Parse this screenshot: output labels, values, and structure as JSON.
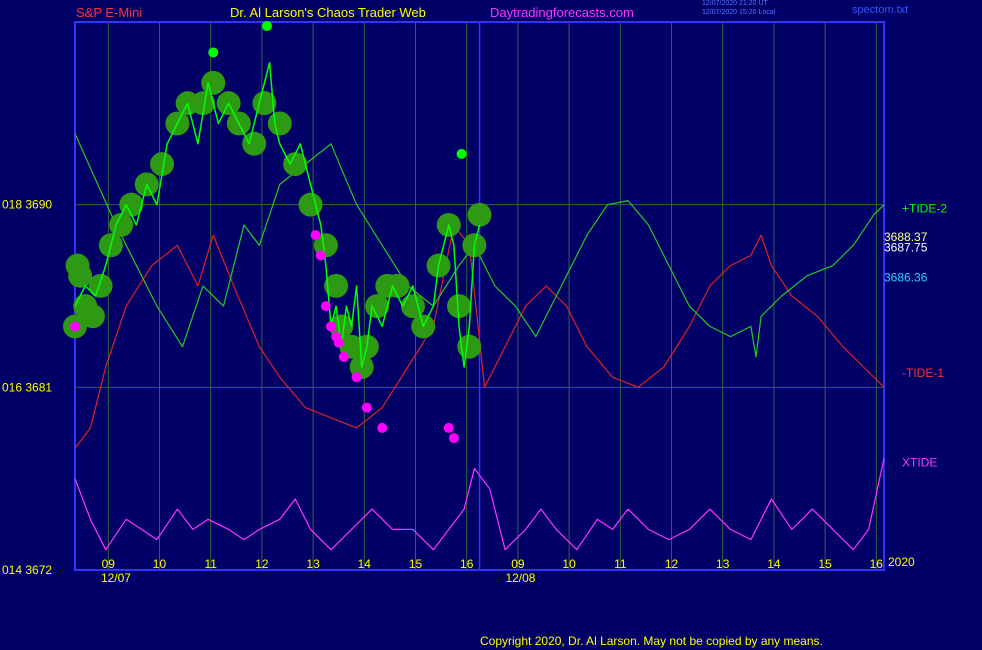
{
  "header": {
    "symbol": "S&P E-Mini",
    "site_title": "Dr. Al Larson's Chaos Trader Web",
    "site_url": "Daytradingforecasts.com",
    "stamp_ut": "12/07/2020 21:20 UT",
    "stamp_local": "12/07/2020 15:20 Local",
    "filename": "spectom.txt",
    "copyright": "Copyright 2020, Dr. Al Larson. May not be copied by any means."
  },
  "colors": {
    "background": "#000066",
    "frame": "#3333ff",
    "grid": "#336633",
    "price": "#00ff00",
    "price_glow": "#2e9a14",
    "signal_dot": "#ff00ff",
    "fast_avg": "#ffff00",
    "mid_avg": "#33ccff",
    "slow_avg": "#ffffff",
    "tide_plus2": "#22cc22",
    "tide_minus1": "#dd2222",
    "xtide": "#ff33ff",
    "axis_text": "#ffff00"
  },
  "chart_data": {
    "type": "line",
    "title": "S&P E-Mini",
    "y_axis": {
      "ticks": [
        {
          "price": 3672,
          "label": "014  3672"
        },
        {
          "price": 3681,
          "label": "016  3681"
        },
        {
          "price": 3690,
          "label": "018  3690"
        }
      ]
    },
    "x_axis": {
      "hour_ticks": [
        {
          "x": 0.65,
          "label": "09"
        },
        {
          "x": 1.65,
          "label": "10"
        },
        {
          "x": 2.65,
          "label": "11"
        },
        {
          "x": 3.65,
          "label": "12"
        },
        {
          "x": 4.65,
          "label": "13"
        },
        {
          "x": 5.65,
          "label": "14"
        },
        {
          "x": 6.65,
          "label": "15"
        },
        {
          "x": 7.65,
          "label": "16"
        },
        {
          "x": 8.65,
          "label": "09"
        },
        {
          "x": 9.65,
          "label": "10"
        },
        {
          "x": 10.65,
          "label": "11"
        },
        {
          "x": 11.65,
          "label": "12"
        },
        {
          "x": 12.65,
          "label": "13"
        },
        {
          "x": 13.65,
          "label": "14"
        },
        {
          "x": 14.65,
          "label": "15"
        },
        {
          "x": 15.65,
          "label": "16"
        }
      ],
      "date_labels": [
        {
          "x": 0.8,
          "label": "12/07"
        },
        {
          "x": 8.7,
          "label": "12/08"
        }
      ],
      "year_label": "2020",
      "now_x": 7.9,
      "range": [
        0,
        15.8
      ]
    },
    "y_range": [
      3672,
      3699
    ],
    "price": [
      [
        0,
        3685
      ],
      [
        0.2,
        3686
      ],
      [
        0.4,
        3685.5
      ],
      [
        0.6,
        3687
      ],
      [
        0.8,
        3689
      ],
      [
        1,
        3690
      ],
      [
        1.2,
        3689
      ],
      [
        1.4,
        3691
      ],
      [
        1.6,
        3690
      ],
      [
        1.8,
        3693
      ],
      [
        2,
        3694
      ],
      [
        2.2,
        3695
      ],
      [
        2.4,
        3693
      ],
      [
        2.6,
        3696
      ],
      [
        2.8,
        3694
      ],
      [
        3,
        3695
      ],
      [
        3.2,
        3694
      ],
      [
        3.4,
        3693
      ],
      [
        3.6,
        3695
      ],
      [
        3.8,
        3697
      ],
      [
        3.9,
        3694
      ],
      [
        4,
        3693
      ],
      [
        4.2,
        3692
      ],
      [
        4.4,
        3693
      ],
      [
        4.6,
        3691
      ],
      [
        4.8,
        3689
      ],
      [
        4.9,
        3687
      ],
      [
        5,
        3684
      ],
      [
        5.1,
        3685
      ],
      [
        5.2,
        3683
      ],
      [
        5.3,
        3685
      ],
      [
        5.4,
        3684
      ],
      [
        5.5,
        3686
      ],
      [
        5.6,
        3682
      ],
      [
        5.7,
        3683
      ],
      [
        5.8,
        3685
      ],
      [
        6,
        3684
      ],
      [
        6.2,
        3686
      ],
      [
        6.4,
        3685
      ],
      [
        6.6,
        3686
      ],
      [
        6.8,
        3684
      ],
      [
        7,
        3685
      ],
      [
        7.1,
        3687
      ],
      [
        7.3,
        3689
      ],
      [
        7.4,
        3688
      ],
      [
        7.5,
        3684
      ],
      [
        7.6,
        3682
      ],
      [
        7.7,
        3684
      ],
      [
        7.8,
        3688
      ],
      [
        7.9,
        3689
      ]
    ],
    "fast_average": [
      [
        0,
        3693
      ],
      [
        0.3,
        3687
      ],
      [
        0.6,
        3686.5
      ],
      [
        0.9,
        3688
      ],
      [
        1.2,
        3690
      ],
      [
        1.5,
        3691
      ],
      [
        1.8,
        3693
      ],
      [
        2.1,
        3694
      ],
      [
        2.4,
        3694
      ],
      [
        2.7,
        3694.5
      ],
      [
        3,
        3694
      ],
      [
        3.3,
        3694
      ],
      [
        3.6,
        3694.5
      ],
      [
        3.9,
        3693
      ],
      [
        4.2,
        3692
      ],
      [
        4.5,
        3690
      ],
      [
        4.8,
        3688
      ],
      [
        5,
        3685
      ],
      [
        5.2,
        3684
      ],
      [
        5.4,
        3683
      ],
      [
        5.6,
        3682.5
      ],
      [
        5.8,
        3684
      ],
      [
        6,
        3685
      ],
      [
        6.2,
        3686
      ],
      [
        6.4,
        3685
      ],
      [
        6.6,
        3684
      ],
      [
        6.8,
        3685
      ],
      [
        7,
        3686
      ],
      [
        7.2,
        3688
      ],
      [
        7.4,
        3686
      ],
      [
        7.5,
        3683
      ],
      [
        7.6,
        3684
      ],
      [
        7.8,
        3686
      ],
      [
        7.9,
        3687
      ]
    ],
    "mid_average": [
      [
        0,
        3692
      ],
      [
        0.3,
        3690
      ],
      [
        0.6,
        3689.5
      ],
      [
        0.9,
        3690
      ],
      [
        1.2,
        3690
      ],
      [
        1.5,
        3690.5
      ],
      [
        1.8,
        3692
      ],
      [
        2.1,
        3693
      ],
      [
        2.4,
        3693.5
      ],
      [
        2.7,
        3694
      ],
      [
        3,
        3694
      ],
      [
        3.3,
        3693.8
      ],
      [
        3.6,
        3693.5
      ],
      [
        3.9,
        3692.5
      ],
      [
        4.2,
        3692
      ],
      [
        4.5,
        3691
      ],
      [
        4.8,
        3690
      ],
      [
        5.1,
        3688
      ],
      [
        5.4,
        3687
      ],
      [
        5.7,
        3686
      ],
      [
        6,
        3685.5
      ],
      [
        6.3,
        3685.5
      ],
      [
        6.6,
        3685
      ],
      [
        6.9,
        3685
      ],
      [
        7.2,
        3685.5
      ],
      [
        7.5,
        3685.5
      ],
      [
        7.8,
        3685.5
      ],
      [
        7.9,
        3686
      ]
    ],
    "slow_average": [
      [
        0,
        3687.5
      ],
      [
        0.5,
        3687.5
      ],
      [
        1,
        3688
      ],
      [
        1.5,
        3688.5
      ],
      [
        2,
        3689
      ],
      [
        2.5,
        3689.5
      ],
      [
        3,
        3690
      ],
      [
        3.5,
        3690.5
      ],
      [
        4,
        3691
      ],
      [
        4.5,
        3691
      ],
      [
        5,
        3690.5
      ],
      [
        5.5,
        3689.5
      ],
      [
        6,
        3689
      ],
      [
        6.5,
        3688.8
      ],
      [
        7,
        3688.5
      ],
      [
        7.5,
        3688.3
      ],
      [
        7.9,
        3688.4
      ]
    ],
    "dots": [
      [
        0,
        3684
      ],
      [
        0.05,
        3687
      ],
      [
        0.1,
        3686.5
      ],
      [
        0.2,
        3685
      ],
      [
        0.35,
        3684.5
      ],
      [
        0.5,
        3686
      ],
      [
        0.7,
        3688
      ],
      [
        0.9,
        3689
      ],
      [
        1.1,
        3690
      ],
      [
        1.4,
        3691
      ],
      [
        1.7,
        3692
      ],
      [
        2,
        3694
      ],
      [
        2.2,
        3695
      ],
      [
        2.5,
        3695
      ],
      [
        2.7,
        3696
      ],
      [
        3,
        3695
      ],
      [
        3.2,
        3694
      ],
      [
        3.5,
        3693
      ],
      [
        3.7,
        3695
      ],
      [
        4,
        3694
      ],
      [
        4.3,
        3692
      ],
      [
        4.6,
        3690
      ],
      [
        4.9,
        3688
      ],
      [
        5.1,
        3686
      ],
      [
        5.2,
        3684
      ],
      [
        5.4,
        3683
      ],
      [
        5.6,
        3682
      ],
      [
        5.7,
        3683
      ],
      [
        5.9,
        3685
      ],
      [
        6.1,
        3686
      ],
      [
        6.3,
        3686
      ],
      [
        6.6,
        3685
      ],
      [
        6.8,
        3684
      ],
      [
        7.1,
        3687
      ],
      [
        7.3,
        3689
      ],
      [
        7.5,
        3685
      ],
      [
        7.7,
        3683
      ],
      [
        7.8,
        3688
      ],
      [
        7.9,
        3689.5
      ]
    ],
    "signal_dots": [
      [
        0,
        3684
      ],
      [
        4.7,
        3688.5
      ],
      [
        4.8,
        3687.5
      ],
      [
        4.9,
        3685
      ],
      [
        5.0,
        3684
      ],
      [
        5.1,
        3683.5
      ],
      [
        5.15,
        3683.2
      ],
      [
        5.25,
        3682.5
      ],
      [
        5.5,
        3681.5
      ],
      [
        5.7,
        3680
      ],
      [
        6.0,
        3679
      ],
      [
        7.3,
        3679
      ],
      [
        7.4,
        3678.5
      ]
    ],
    "green_dots": [
      [
        2.7,
        3697.5
      ],
      [
        3.75,
        3698.8
      ],
      [
        7.55,
        3692.5
      ]
    ],
    "tide_plus2": [
      [
        0,
        3693.5
      ],
      [
        0.8,
        3689
      ],
      [
        1.6,
        3685
      ],
      [
        2.1,
        3683
      ],
      [
        2.5,
        3686
      ],
      [
        2.9,
        3685
      ],
      [
        3.3,
        3689
      ],
      [
        3.6,
        3688
      ],
      [
        4,
        3691
      ],
      [
        4.5,
        3692
      ],
      [
        5.0,
        3693
      ],
      [
        5.5,
        3690
      ],
      [
        6,
        3688
      ],
      [
        6.5,
        3686
      ],
      [
        7,
        3685
      ],
      [
        7.5,
        3687
      ],
      [
        7.8,
        3688
      ],
      [
        8.2,
        3686
      ],
      [
        8.6,
        3685
      ],
      [
        9,
        3683.5
      ],
      [
        9.5,
        3686
      ],
      [
        10,
        3688.5
      ],
      [
        10.4,
        3690
      ],
      [
        10.8,
        3690.2
      ],
      [
        11.2,
        3689
      ],
      [
        11.6,
        3687
      ],
      [
        12,
        3685
      ],
      [
        12.4,
        3684
      ],
      [
        12.8,
        3683.5
      ],
      [
        13.2,
        3684
      ],
      [
        13.3,
        3682.5
      ],
      [
        13.4,
        3684.5
      ],
      [
        13.8,
        3685.5
      ],
      [
        14.3,
        3686.5
      ],
      [
        14.8,
        3687
      ],
      [
        15.2,
        3688
      ],
      [
        15.6,
        3689.5
      ],
      [
        15.8,
        3690
      ]
    ],
    "tide_minus1": [
      [
        0,
        3678
      ],
      [
        0.3,
        3679
      ],
      [
        0.6,
        3682
      ],
      [
        1,
        3685
      ],
      [
        1.5,
        3687
      ],
      [
        2,
        3688
      ],
      [
        2.4,
        3686
      ],
      [
        2.7,
        3688.5
      ],
      [
        3.1,
        3686
      ],
      [
        3.6,
        3683
      ],
      [
        4,
        3681.5
      ],
      [
        4.5,
        3680
      ],
      [
        5,
        3679.5
      ],
      [
        5.5,
        3679
      ],
      [
        6,
        3680
      ],
      [
        6.5,
        3682
      ],
      [
        7,
        3684
      ],
      [
        7.4,
        3689
      ],
      [
        7.7,
        3688
      ],
      [
        8,
        3681
      ],
      [
        8.4,
        3683
      ],
      [
        8.8,
        3685
      ],
      [
        9.2,
        3686
      ],
      [
        9.6,
        3685
      ],
      [
        10,
        3683
      ],
      [
        10.5,
        3681.5
      ],
      [
        11,
        3681
      ],
      [
        11.5,
        3682
      ],
      [
        12,
        3684
      ],
      [
        12.4,
        3686
      ],
      [
        12.8,
        3687
      ],
      [
        13.2,
        3687.5
      ],
      [
        13.4,
        3688.5
      ],
      [
        13.6,
        3687
      ],
      [
        14,
        3685.5
      ],
      [
        14.5,
        3684.5
      ],
      [
        15,
        3683
      ],
      [
        15.4,
        3682
      ],
      [
        15.8,
        3681
      ]
    ],
    "xtide": [
      [
        0,
        3676.5
      ],
      [
        0.3,
        3674.5
      ],
      [
        0.6,
        3673
      ],
      [
        1,
        3674.5
      ],
      [
        1.3,
        3674
      ],
      [
        1.6,
        3673.5
      ],
      [
        2,
        3675
      ],
      [
        2.3,
        3674
      ],
      [
        2.6,
        3674.5
      ],
      [
        3,
        3674
      ],
      [
        3.3,
        3673.5
      ],
      [
        3.6,
        3674
      ],
      [
        4,
        3674.5
      ],
      [
        4.3,
        3675.5
      ],
      [
        4.6,
        3674
      ],
      [
        5,
        3673
      ],
      [
        5.4,
        3674
      ],
      [
        5.8,
        3675
      ],
      [
        6.2,
        3674
      ],
      [
        6.6,
        3674
      ],
      [
        7,
        3673
      ],
      [
        7.3,
        3674
      ],
      [
        7.6,
        3675
      ],
      [
        7.8,
        3677
      ],
      [
        8.1,
        3676
      ],
      [
        8.4,
        3673
      ],
      [
        8.8,
        3674
      ],
      [
        9.1,
        3675
      ],
      [
        9.4,
        3674
      ],
      [
        9.8,
        3673
      ],
      [
        10.2,
        3674.5
      ],
      [
        10.5,
        3674
      ],
      [
        10.8,
        3675
      ],
      [
        11.2,
        3674
      ],
      [
        11.6,
        3673.5
      ],
      [
        12,
        3674
      ],
      [
        12.4,
        3675
      ],
      [
        12.8,
        3674
      ],
      [
        13.2,
        3673.5
      ],
      [
        13.6,
        3675.5
      ],
      [
        14,
        3674
      ],
      [
        14.4,
        3675
      ],
      [
        14.8,
        3674
      ],
      [
        15.2,
        3673
      ],
      [
        15.5,
        3674
      ],
      [
        15.8,
        3677.5
      ]
    ],
    "line_labels": [
      {
        "name": "+TIDE-2",
        "price": 3689.8,
        "color": "#00ff00"
      },
      {
        "name": "-TIDE-1",
        "price": 3681.7,
        "color": "#ff3333"
      },
      {
        "name": "XTIDE",
        "price": 3677.3,
        "color": "#ff33ff"
      }
    ],
    "price_readouts": [
      {
        "value": "3688.37",
        "price": 3688.4,
        "color": "#ffff88"
      },
      {
        "value": "3687.75",
        "price": 3687.9,
        "color": "#ffffff"
      },
      {
        "value": "3686.36",
        "price": 3686.4,
        "color": "#33ccff"
      }
    ]
  }
}
